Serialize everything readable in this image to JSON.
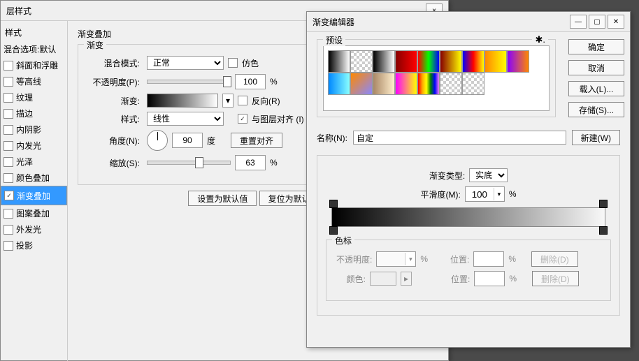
{
  "layer_style": {
    "title_suffix": "层样式",
    "styles_header": "样式",
    "blend_default": "混合选项:默认",
    "items": [
      {
        "label": "斜面和浮雕",
        "checked": false
      },
      {
        "label": "等高线",
        "checked": false
      },
      {
        "label": "纹理",
        "checked": false
      },
      {
        "label": "描边",
        "checked": false
      },
      {
        "label": "内阴影",
        "checked": false
      },
      {
        "label": "内发光",
        "checked": false
      },
      {
        "label": "光泽",
        "checked": false
      },
      {
        "label": "颜色叠加",
        "checked": false
      },
      {
        "label": "渐变叠加",
        "checked": true,
        "selected": true
      },
      {
        "label": "图案叠加",
        "checked": false
      },
      {
        "label": "外发光",
        "checked": false
      },
      {
        "label": "投影",
        "checked": false
      }
    ],
    "panel_title": "渐变叠加",
    "subtitle": "渐变",
    "blend_mode_label": "混合模式:",
    "blend_mode_value": "正常",
    "dither_label": "仿色",
    "opacity_label": "不透明度(P):",
    "opacity_value": "100",
    "opacity_unit": "%",
    "gradient_label": "渐变:",
    "reverse_label": "反向(R)",
    "style_label": "样式:",
    "style_value": "线性",
    "align_label": "与图层对齐 (I)",
    "angle_label": "角度(N):",
    "angle_value": "90",
    "angle_unit": "度",
    "reset_align": "重置对齐",
    "scale_label": "缩放(S):",
    "scale_value": "63",
    "scale_unit": "%",
    "set_default": "设置为默认值",
    "reset_default": "复位为默认值"
  },
  "grad_editor": {
    "title": "渐变编辑器",
    "presets_label": "预设",
    "ok": "确定",
    "cancel": "取消",
    "load": "载入(L)...",
    "save": "存储(S)...",
    "name_label": "名称(N):",
    "name_value": "自定",
    "new_btn": "新建(W)",
    "type_label": "渐变类型:",
    "type_value": "实底",
    "smooth_label": "平滑度(M):",
    "smooth_value": "100",
    "smooth_unit": "%",
    "stops_label": "色标",
    "opacity_label": "不透明度:",
    "position_label": "位置:",
    "color_label": "颜色:",
    "delete": "删除(D)",
    "unit_pct": "%",
    "swatches": [
      "linear-gradient(to right,#000,#fff)",
      "repeating-conic-gradient(#ccc 0 25%,#fff 0 50%) 0/8px 8px",
      "linear-gradient(to right,#000,#fff)",
      "linear-gradient(to right,#800,#f00)",
      "linear-gradient(to right,#f00,#0f0,#00f)",
      "linear-gradient(to right,#800,#ff0)",
      "linear-gradient(to right,#00f,#f00,#ff0)",
      "linear-gradient(to right,#f80,#ff0)",
      "linear-gradient(to right,#80f,#f80)",
      "linear-gradient(to right,#08f,#8ff)",
      "linear-gradient(135deg,#f80,#88f)",
      "linear-gradient(to right,#a86,#fec)",
      "linear-gradient(to right,#f0f,#ff0)",
      "linear-gradient(to right,red,orange,yellow,green,blue,violet)",
      "repeating-conic-gradient(#ccc 0 25%,#fff 0 50%) 0/8px 8px",
      "repeating-conic-gradient(#ccc 0 25%,#fff 0 50%) 0/8px 8px"
    ]
  }
}
